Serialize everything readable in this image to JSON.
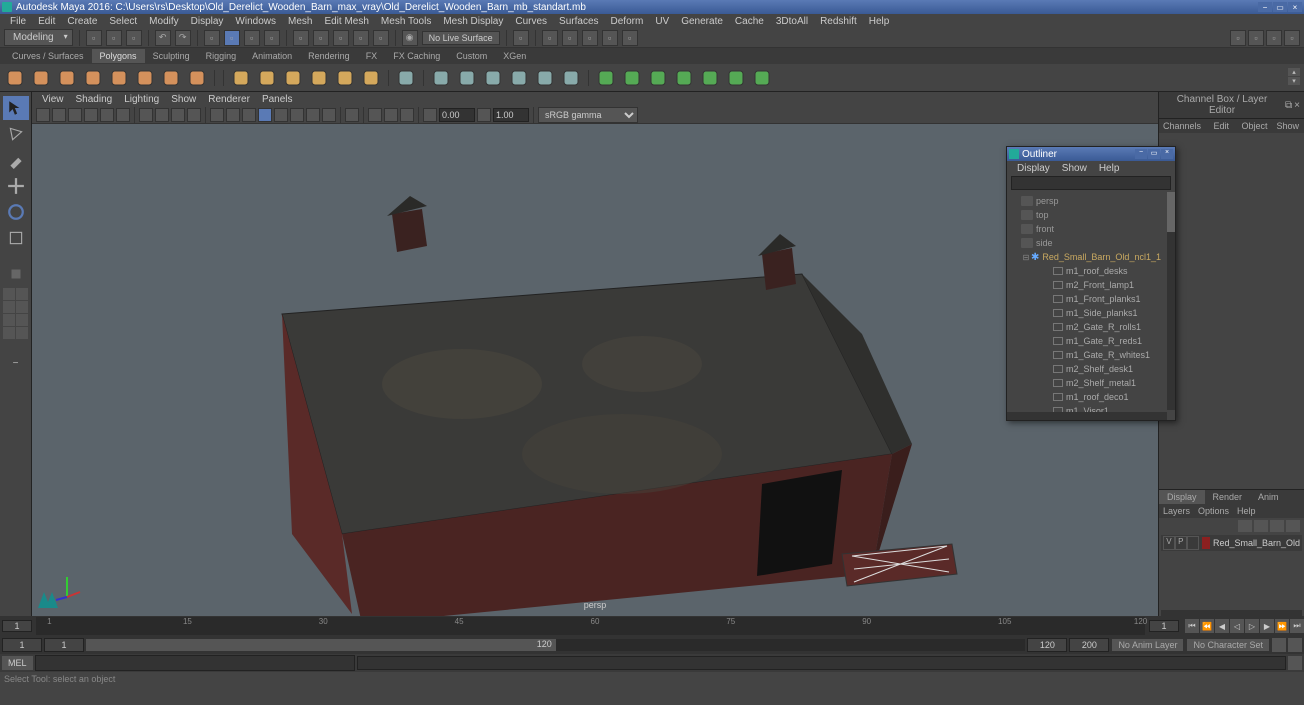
{
  "title": "Autodesk Maya 2016: C:\\Users\\rs\\Desktop\\Old_Derelict_Wooden_Barn_max_vray\\Old_Derelict_Wooden_Barn_mb_standart.mb",
  "main_menu": [
    "File",
    "Edit",
    "Create",
    "Select",
    "Modify",
    "Display",
    "Windows",
    "Mesh",
    "Edit Mesh",
    "Mesh Tools",
    "Mesh Display",
    "Curves",
    "Surfaces",
    "Deform",
    "UV",
    "Generate",
    "Cache",
    "3DtoAll",
    "Redshift",
    "Help"
  ],
  "mode": "Modeling",
  "status_line": {
    "masking": "No Live Surface"
  },
  "shelf_tabs": [
    "Curves / Surfaces",
    "Polygons",
    "Sculpting",
    "Rigging",
    "Animation",
    "Rendering",
    "FX",
    "FX Caching",
    "Custom",
    "XGen"
  ],
  "active_shelf": "Polygons",
  "panel_menu": [
    "View",
    "Shading",
    "Lighting",
    "Show",
    "Renderer",
    "Panels"
  ],
  "panel_toolbar": {
    "exposure": "0.00",
    "gamma": "1.00",
    "color_mgmt": "sRGB gamma"
  },
  "camera_name": "persp",
  "channel_box": {
    "title": "Channel Box / Layer Editor",
    "tabs": [
      "Channels",
      "Edit",
      "Object",
      "Show"
    ],
    "lower_tabs": [
      "Display",
      "Render",
      "Anim"
    ],
    "active_lower": "Display",
    "layer_menu": [
      "Layers",
      "Options",
      "Help"
    ],
    "layers": [
      {
        "vis": "V",
        "play": "P",
        "color": "#8b2020",
        "name": "Red_Small_Barn_Old"
      }
    ]
  },
  "outliner": {
    "title": "Outliner",
    "menu": [
      "Display",
      "Show",
      "Help"
    ],
    "cameras": [
      "persp",
      "top",
      "front",
      "side"
    ],
    "group": "Red_Small_Barn_Old_ncl1_1",
    "meshes": [
      "m1_roof_desks",
      "m2_Front_lamp1",
      "m1_Front_planks1",
      "m1_Side_planks1",
      "m2_Gate_R_rolls1",
      "m1_Gate_R_reds1",
      "m1_Gate_R_whites1",
      "m2_Shelf_desk1",
      "m2_Shelf_metal1",
      "m1_roof_deco1",
      "m1_Visor1"
    ]
  },
  "timeline": {
    "start_visible": "1",
    "end_visible": "1",
    "ticks": [
      "1",
      "15",
      "30",
      "45",
      "60",
      "75",
      "90",
      "105",
      "120"
    ],
    "range_start": "1",
    "range_start2": "1",
    "range_end_visible": "120",
    "range_end": "120",
    "range_total": "200",
    "anim_layer": "No Anim Layer",
    "char_set": "No Character Set"
  },
  "cmd": {
    "lang": "MEL"
  },
  "help_text": "Select Tool: select an object"
}
